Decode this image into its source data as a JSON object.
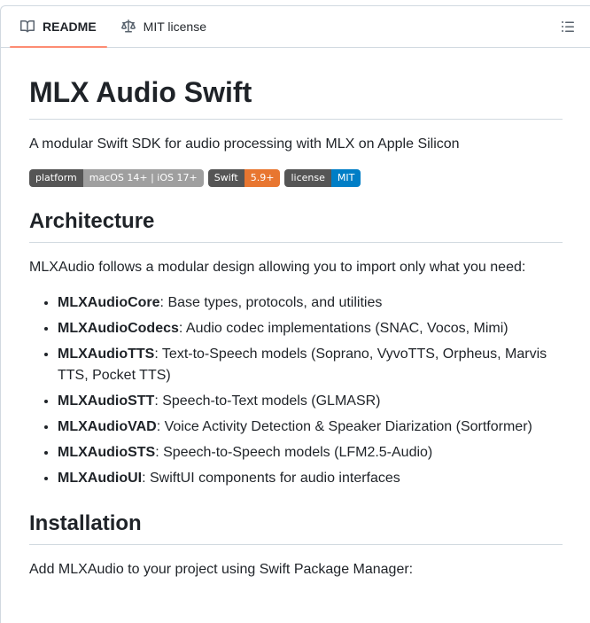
{
  "colors": {
    "border": "#d1d9e0",
    "active_tab_underline": "#fd8c73",
    "icon_gray": "#59636e",
    "text": "#1f2328",
    "badge_label_bg": "#555555",
    "badge_platform_bg": "#9f9f9f",
    "badge_swift_bg": "#e87630",
    "badge_license_bg": "#007ec6"
  },
  "tabbar": {
    "readme_label": "README",
    "license_label": "MIT license"
  },
  "readme": {
    "title": "MLX Audio Swift",
    "description": "A modular Swift SDK for audio processing with MLX on Apple Silicon",
    "badges": [
      {
        "label": "platform",
        "value": "macOS 14+ | iOS 17+",
        "label_bg": "#555555",
        "value_bg": "#9f9f9f"
      },
      {
        "label": "Swift",
        "value": "5.9+",
        "label_bg": "#555555",
        "value_bg": "#e87630"
      },
      {
        "label": "license",
        "value": "MIT",
        "label_bg": "#555555",
        "value_bg": "#007ec6"
      }
    ],
    "architecture": {
      "heading": "Architecture",
      "intro": "MLXAudio follows a modular design allowing you to import only what you need:",
      "items": [
        {
          "name": "MLXAudioCore",
          "desc": ": Base types, protocols, and utilities"
        },
        {
          "name": "MLXAudioCodecs",
          "desc": ": Audio codec implementations (SNAC, Vocos, Mimi)"
        },
        {
          "name": "MLXAudioTTS",
          "desc": ": Text-to-Speech models (Soprano, VyvoTTS, Orpheus, Marvis TTS, Pocket TTS)"
        },
        {
          "name": "MLXAudioSTT",
          "desc": ": Speech-to-Text models (GLMASR)"
        },
        {
          "name": "MLXAudioVAD",
          "desc": ": Voice Activity Detection & Speaker Diarization (Sortformer)"
        },
        {
          "name": "MLXAudioSTS",
          "desc": ": Speech-to-Speech models (LFM2.5-Audio)"
        },
        {
          "name": "MLXAudioUI",
          "desc": ": SwiftUI components for audio interfaces"
        }
      ]
    },
    "installation": {
      "heading": "Installation",
      "intro": "Add MLXAudio to your project using Swift Package Manager:"
    }
  }
}
